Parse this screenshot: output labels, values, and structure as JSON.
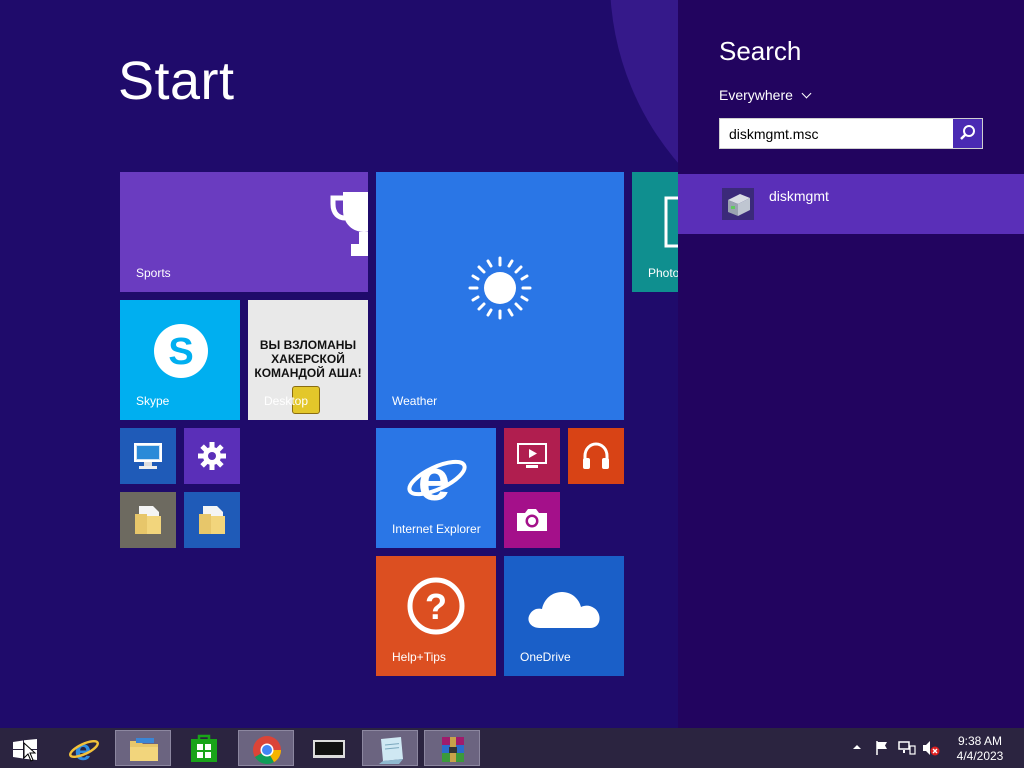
{
  "start": {
    "title": "Start",
    "tiles": {
      "sports": "Sports",
      "skype": "Skype",
      "desktop": "Desktop",
      "desktop_lines": [
        "ВЫ ВЗЛОМАНЫ",
        "ХАКЕРСКОЙ",
        "КОМАНДОЙ АША!"
      ],
      "weather": "Weather",
      "photos": "Photo",
      "internet_explorer": "Internet Explorer",
      "help_tips": "Help+Tips",
      "onedrive": "OneDrive"
    }
  },
  "search": {
    "title": "Search",
    "scope": "Everywhere",
    "query": "diskmgmt.msc",
    "results": [
      {
        "label": "diskmgmt"
      }
    ]
  },
  "taskbar": {
    "time": "9:38 AM",
    "date": "4/4/2023"
  },
  "colors": {
    "start_background": "#1f0b6b",
    "search_pane": "#22045f",
    "selected_result": "#5a2fb8",
    "sports_tile": "#6a3cc0",
    "skype_tile": "#00aff0",
    "weather_tile": "#2a76e6",
    "ie_tile": "#2a76e6",
    "help_tile": "#dc4f21",
    "onedrive_tile": "#1a5fc8",
    "video_tile": "#b01e4f",
    "music_tile": "#d84315",
    "camera_tile": "#a4108a"
  }
}
